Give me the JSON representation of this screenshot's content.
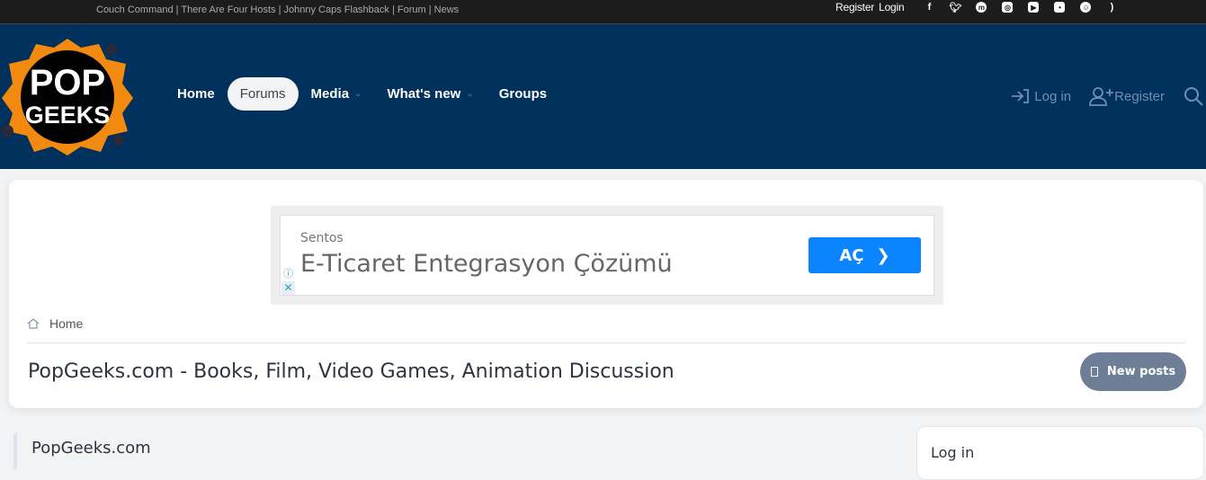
{
  "topbar": {
    "links": [
      "Couch Command",
      "There Are Four Hosts",
      "Johnny Caps Flashback",
      "Forum",
      "News"
    ],
    "register": "Register",
    "login": "Login",
    "social": [
      "facebook",
      "twitter",
      "mastodon",
      "instagram",
      "youtube",
      "discord",
      "reddit",
      "rss"
    ]
  },
  "brand": {
    "logo_text": "POP GEEKS"
  },
  "nav": {
    "items": [
      {
        "label": "Home"
      },
      {
        "label": "Forums"
      },
      {
        "label": "Media"
      },
      {
        "label": "What's new"
      },
      {
        "label": "Groups"
      }
    ],
    "login": "Log in",
    "register": "Register"
  },
  "ad": {
    "source": "Sentos",
    "title": "E-Ticaret Entegrasyon Çözümü",
    "button": "AÇ"
  },
  "breadcrumb": {
    "home": "Home"
  },
  "page": {
    "title": "PopGeeks.com - Books, Film, Video Games, Animation Discussion",
    "new_posts": "New posts"
  },
  "section": {
    "title": "PopGeeks.com"
  },
  "sidebar": {
    "login_title": "Log in"
  },
  "colors": {
    "header": "#00305c",
    "topbar": "#1c1c1c",
    "accent": "#0a84ff",
    "button": "#6e7e96"
  }
}
